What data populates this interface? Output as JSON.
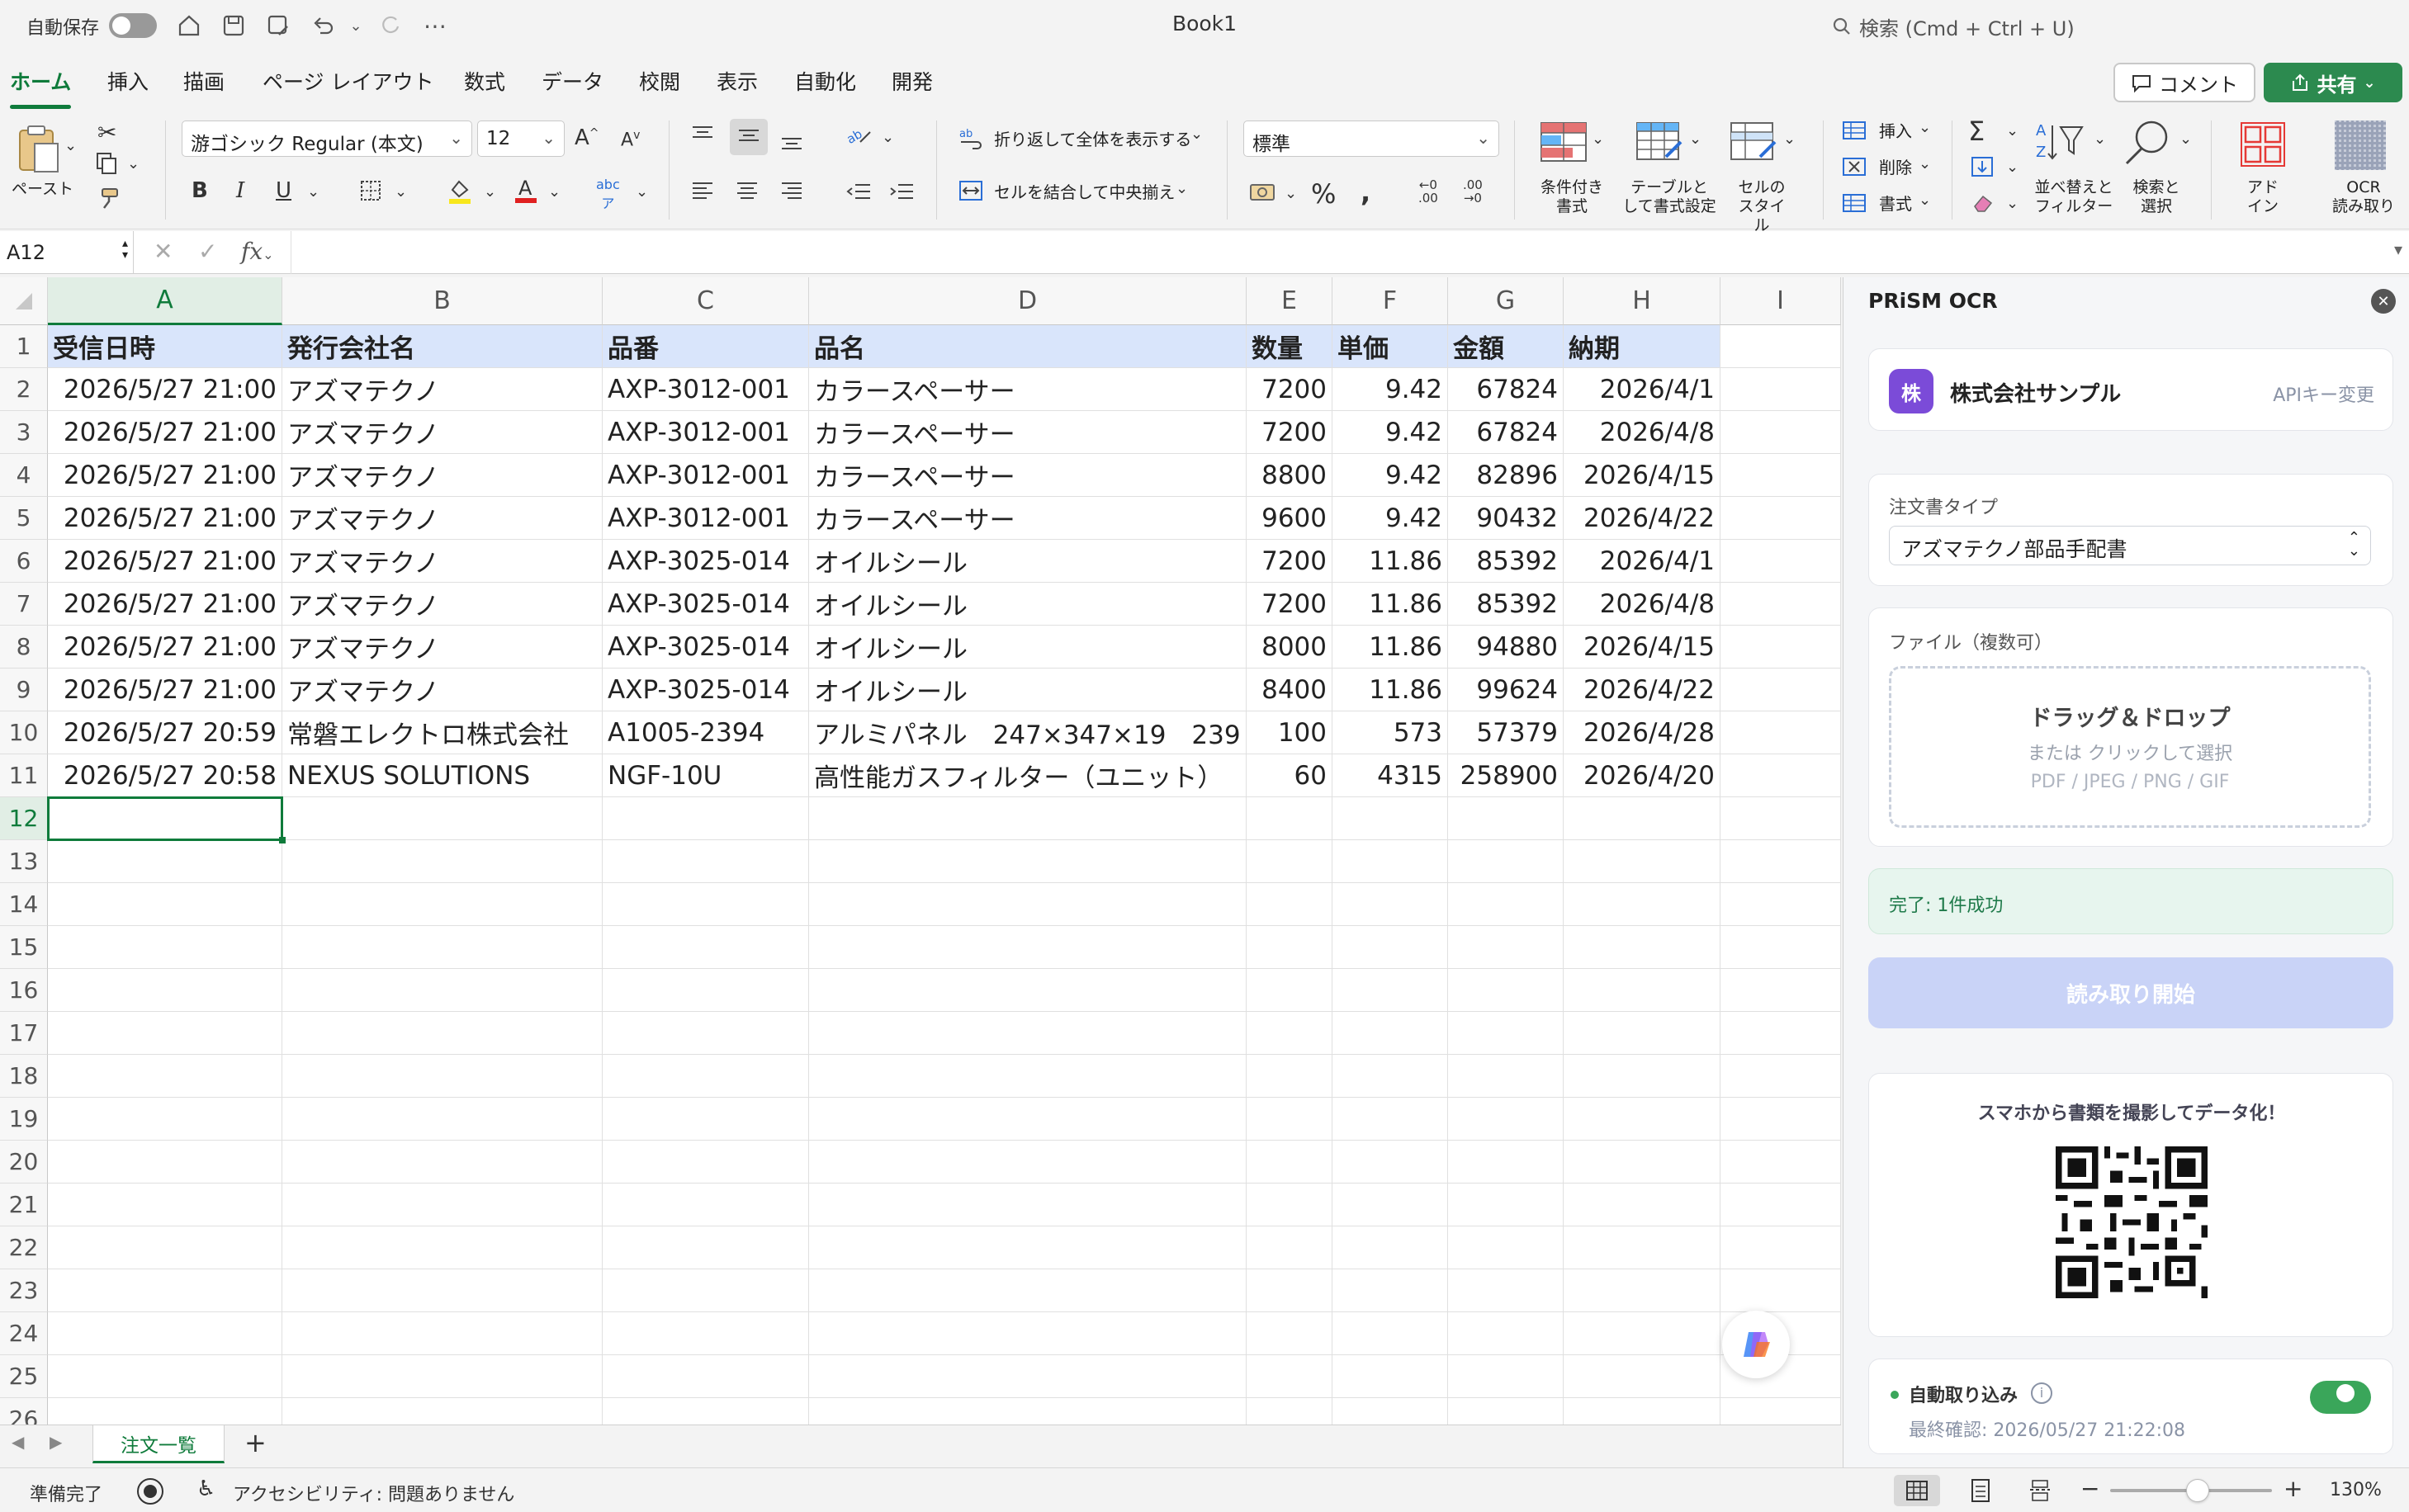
{
  "titlebar": {
    "autosave_label": "自動保存",
    "doc_title": "Book1",
    "search_placeholder": "検索 (Cmd + Ctrl + U)"
  },
  "tabs": [
    "ホーム",
    "挿入",
    "描画",
    "ページ レイアウト",
    "数式",
    "データ",
    "校閲",
    "表示",
    "自動化",
    "開発"
  ],
  "active_tab": "ホーム",
  "comment_label": "コメント",
  "share_label": "共有",
  "ribbon": {
    "paste": "ペースト",
    "font_name": "游ゴシック Regular (本文)",
    "font_size": "12",
    "wrap_text": "折り返して全体を表示する",
    "merge_center": "セルを結合して中央揃え",
    "number_format": "標準",
    "cond_format": [
      "条件付き",
      "書式"
    ],
    "table_format": [
      "テーブルと",
      "して書式設定"
    ],
    "cell_styles": [
      "セルの",
      "スタイル"
    ],
    "insert": "挿入",
    "delete": "削除",
    "format": "書式",
    "sort_filter": [
      "並べ替えと",
      "フィルター"
    ],
    "find_select": [
      "検索と",
      "選択"
    ],
    "addins": [
      "アド",
      "イン"
    ],
    "ocr": [
      "OCR",
      "読み取り"
    ]
  },
  "formula_bar": {
    "name_box": "A12",
    "fx": "fx",
    "value": ""
  },
  "grid": {
    "columns": [
      "A",
      "B",
      "C",
      "D",
      "E",
      "F",
      "G",
      "H",
      "I"
    ],
    "row_numbers": [
      "1",
      "2",
      "3",
      "4",
      "5",
      "6",
      "7",
      "8",
      "9",
      "10",
      "11",
      "12",
      "13",
      "14",
      "15",
      "16",
      "17",
      "18",
      "19",
      "20",
      "21",
      "22",
      "23",
      "24",
      "25",
      "26"
    ],
    "header": [
      "受信日時",
      "発行会社名",
      "品番",
      "品名",
      "数量",
      "単価",
      "金額",
      "納期"
    ],
    "rows": [
      [
        "2026/5/27 21:00",
        "アズマテクノ",
        "AXP-3012-001",
        "カラースペーサー",
        "7200",
        "9.42",
        "67824",
        "2026/4/1"
      ],
      [
        "2026/5/27 21:00",
        "アズマテクノ",
        "AXP-3012-001",
        "カラースペーサー",
        "7200",
        "9.42",
        "67824",
        "2026/4/8"
      ],
      [
        "2026/5/27 21:00",
        "アズマテクノ",
        "AXP-3012-001",
        "カラースペーサー",
        "8800",
        "9.42",
        "82896",
        "2026/4/15"
      ],
      [
        "2026/5/27 21:00",
        "アズマテクノ",
        "AXP-3012-001",
        "カラースペーサー",
        "9600",
        "9.42",
        "90432",
        "2026/4/22"
      ],
      [
        "2026/5/27 21:00",
        "アズマテクノ",
        "AXP-3025-014",
        "オイルシール",
        "7200",
        "11.86",
        "85392",
        "2026/4/1"
      ],
      [
        "2026/5/27 21:00",
        "アズマテクノ",
        "AXP-3025-014",
        "オイルシール",
        "7200",
        "11.86",
        "85392",
        "2026/4/8"
      ],
      [
        "2026/5/27 21:00",
        "アズマテクノ",
        "AXP-3025-014",
        "オイルシール",
        "8000",
        "11.86",
        "94880",
        "2026/4/15"
      ],
      [
        "2026/5/27 21:00",
        "アズマテクノ",
        "AXP-3025-014",
        "オイルシール",
        "8400",
        "11.86",
        "99624",
        "2026/4/22"
      ],
      [
        "2026/5/27 20:59",
        "常磐エレクトロ株式会社",
        "A1005-2394",
        "アルミパネル　247×347×19　239",
        "100",
        "573",
        "57379",
        "2026/4/28"
      ],
      [
        "2026/5/27 20:58",
        "NEXUS SOLUTIONS",
        "NGF-10U",
        "高性能ガスフィルター（ユニット）",
        "60",
        "4315",
        "258900",
        "2026/4/20"
      ]
    ],
    "selected_cell": "A12"
  },
  "sheet_tab": "注文一覧",
  "statusbar": {
    "ready": "準備完了",
    "accessibility": "アクセシビリティ: 問題ありません",
    "zoom": "130%"
  },
  "panel": {
    "title": "PRiSM OCR",
    "company_badge": "株",
    "company_name": "株式会社サンプル",
    "api_key_link": "APIキー変更",
    "order_type_label": "注文書タイプ",
    "order_type_value": "アズマテクノ部品手配書",
    "file_label": "ファイル（複数可）",
    "drop_title": "ドラッグ＆ドロップ",
    "drop_sub": "または クリックして選択",
    "drop_formats": "PDF / JPEG / PNG / GIF",
    "status": "完了: 1件成功",
    "start_button": "読み取り開始",
    "qr_caption": "スマホから書類を撮影してデータ化！",
    "auto_import_label": "自動取り込み",
    "auto_import_on": true,
    "last_check": "最終確認: 2026/05/27 21:22:08",
    "accent": "#3aa65a",
    "status_bg": "#e7f5ee",
    "status_color": "#1f7a4a"
  }
}
